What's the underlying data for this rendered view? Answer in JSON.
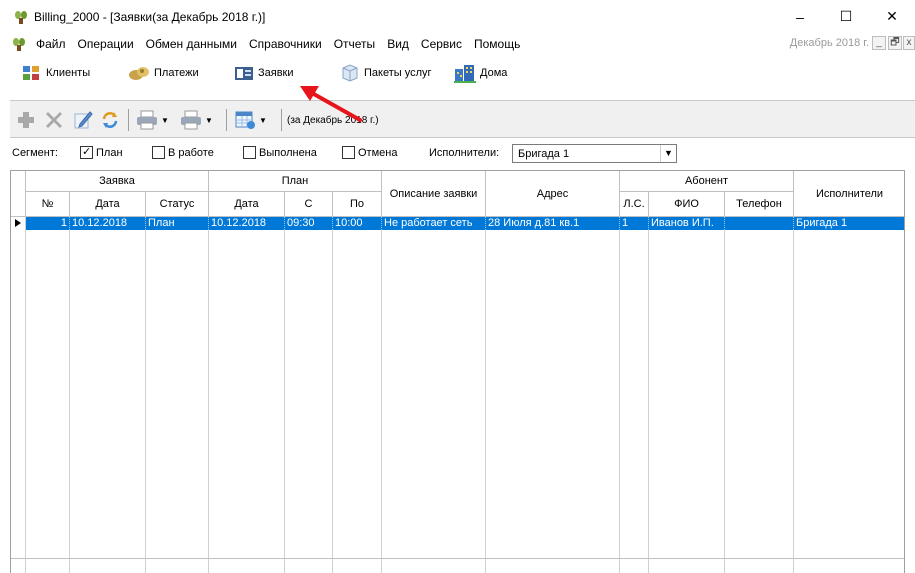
{
  "window": {
    "title": "Billing_2000 - [Заявки(за Декабрь 2018 г.)]",
    "minimize": "–",
    "maximize": "☐",
    "close": "✕"
  },
  "menu": {
    "items": [
      "Файл",
      "Операции",
      "Обмен данными",
      "Справочники",
      "Отчеты",
      "Вид",
      "Сервис",
      "Помощь"
    ],
    "period": "Декабрь 2018 г.",
    "mdi_min": "_",
    "mdi_restore": "🗗",
    "mdi_close": "x"
  },
  "nav": {
    "clients": "Клиенты",
    "payments": "Платежи",
    "requests": "Заявки",
    "packages": "Пакеты услуг",
    "houses": "Дома"
  },
  "toolbar": {
    "period_label": "(за Декабрь 2018 г.)"
  },
  "filter": {
    "segment_label": "Сегмент:",
    "plan_label": "План",
    "plan_checked": true,
    "in_work_label": "В работе",
    "done_label": "Выполнена",
    "cancel_label": "Отмена",
    "executors_label": "Исполнители:",
    "executors_value": "Бригада 1"
  },
  "grid": {
    "group_request": "Заявка",
    "group_plan": "План",
    "group_subscriber": "Абонент",
    "col_no": "№",
    "col_date": "Дата",
    "col_status": "Статус",
    "col_plan_date": "Дата",
    "col_from": "С",
    "col_to": "По",
    "col_description": "Описание заявки",
    "col_address": "Адрес",
    "col_account": "Л.С.",
    "col_name": "ФИО",
    "col_phone": "Телефон",
    "col_executors": "Исполнители",
    "rows": [
      {
        "no": "1",
        "date": "10.12.2018",
        "status": "План",
        "plan_date": "10.12.2018",
        "from": "09:30",
        "to": "10:00",
        "description": "Не работает сеть",
        "address": "28 Июля д.81 кв.1",
        "account": "1",
        "name": "Иванов И.П.",
        "phone": "",
        "executors": "Бригада 1"
      }
    ]
  },
  "colors": {
    "selection": "#0078d7",
    "annotation_arrow": "#e8141b"
  }
}
